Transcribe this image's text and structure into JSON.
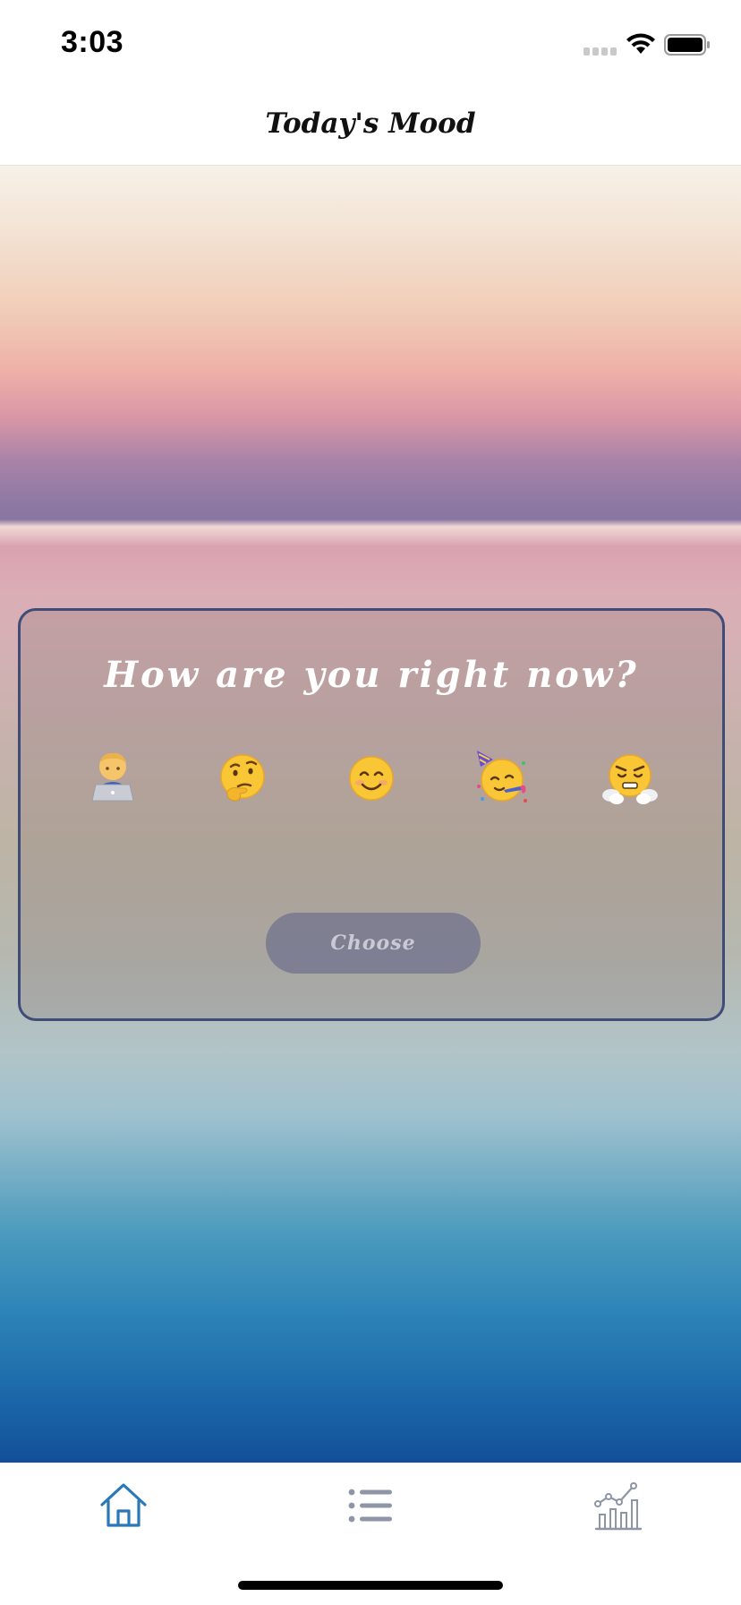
{
  "status_bar": {
    "time": "3:03",
    "icons": [
      "cellular-signal-icon",
      "wifi-icon",
      "battery-icon"
    ]
  },
  "nav": {
    "title": "Today's Mood"
  },
  "mood_card": {
    "question": "How are you right now?",
    "options": [
      {
        "name": "person-with-laptop-emoji",
        "glyph": "🧑‍💻"
      },
      {
        "name": "thinking-face-emoji",
        "glyph": "🤔"
      },
      {
        "name": "smiling-face-emoji",
        "glyph": "😊"
      },
      {
        "name": "partying-face-emoji",
        "glyph": "🥳"
      },
      {
        "name": "face-with-steam-emoji",
        "glyph": "😤"
      }
    ],
    "choose_label": "Choose"
  },
  "tab_bar": {
    "tabs": [
      {
        "icon": "home-icon",
        "selected": true
      },
      {
        "icon": "list-icon",
        "selected": false
      },
      {
        "icon": "stats-chart-icon",
        "selected": false
      }
    ]
  },
  "colors": {
    "accent": "#2a78b8",
    "tab_inactive": "#8e95a5",
    "card_border": "#3f4c78",
    "button_bg": "#6e708c"
  }
}
